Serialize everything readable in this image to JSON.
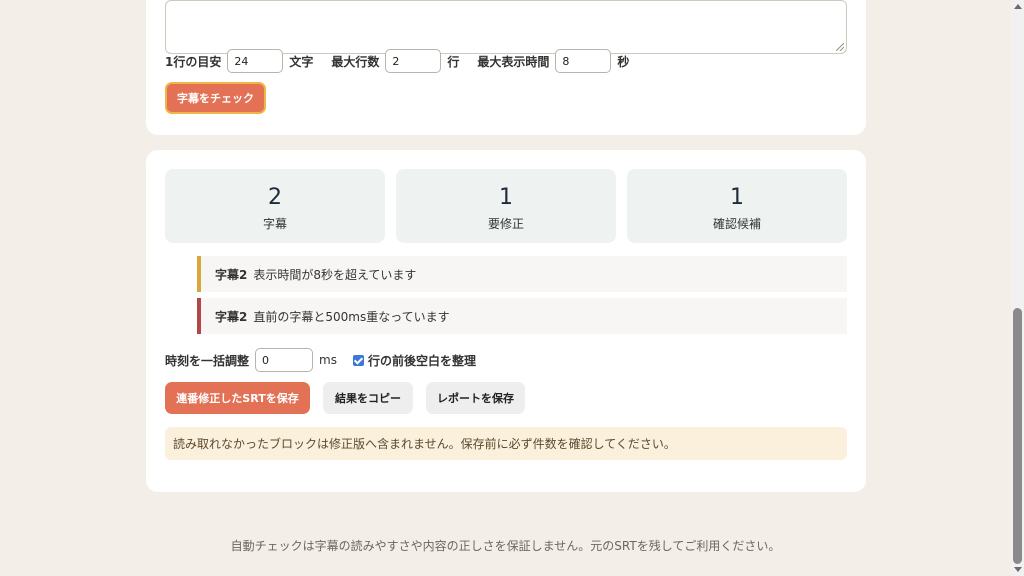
{
  "settings": {
    "line_length_label": "1行の目安",
    "line_length_value": "24",
    "line_length_unit": "文字",
    "max_lines_label": "最大行数",
    "max_lines_value": "2",
    "max_lines_unit": "行",
    "max_duration_label": "最大表示時間",
    "max_duration_value": "8",
    "max_duration_unit": "秒",
    "check_button": "字幕をチェック"
  },
  "stats": [
    {
      "value": "2",
      "caption": "字幕"
    },
    {
      "value": "1",
      "caption": "要修正"
    },
    {
      "value": "1",
      "caption": "確認候補"
    }
  ],
  "issues": [
    {
      "tag": "字幕2",
      "message": "表示時間が8秒を超えています",
      "color": "#d9a63a"
    },
    {
      "tag": "字幕2",
      "message": "直前の字幕と500ms重なっています",
      "color": "#b2474a"
    }
  ],
  "offset": {
    "label": "時刻を一括調整",
    "value": "0",
    "unit": "ms",
    "trim_label": "行の前後空白を整理",
    "trim_checked": true
  },
  "actions": {
    "save_srt": "連番修正したSRTを保存",
    "copy": "結果をコピー",
    "save_report": "レポートを保存"
  },
  "notice": "読み取れなかったブロックは修正版へ含まれません。保存前に必ず件数を確認してください。",
  "footer": "自動チェックは字幕の読みやすさや内容の正しさを保証しません。元のSRTを残してご利用ください。",
  "colors": {
    "accent": "#e27155",
    "accent_border": "#f0b545",
    "warning": "#d9a63a",
    "error": "#b2474a",
    "background": "#f3efe8"
  }
}
